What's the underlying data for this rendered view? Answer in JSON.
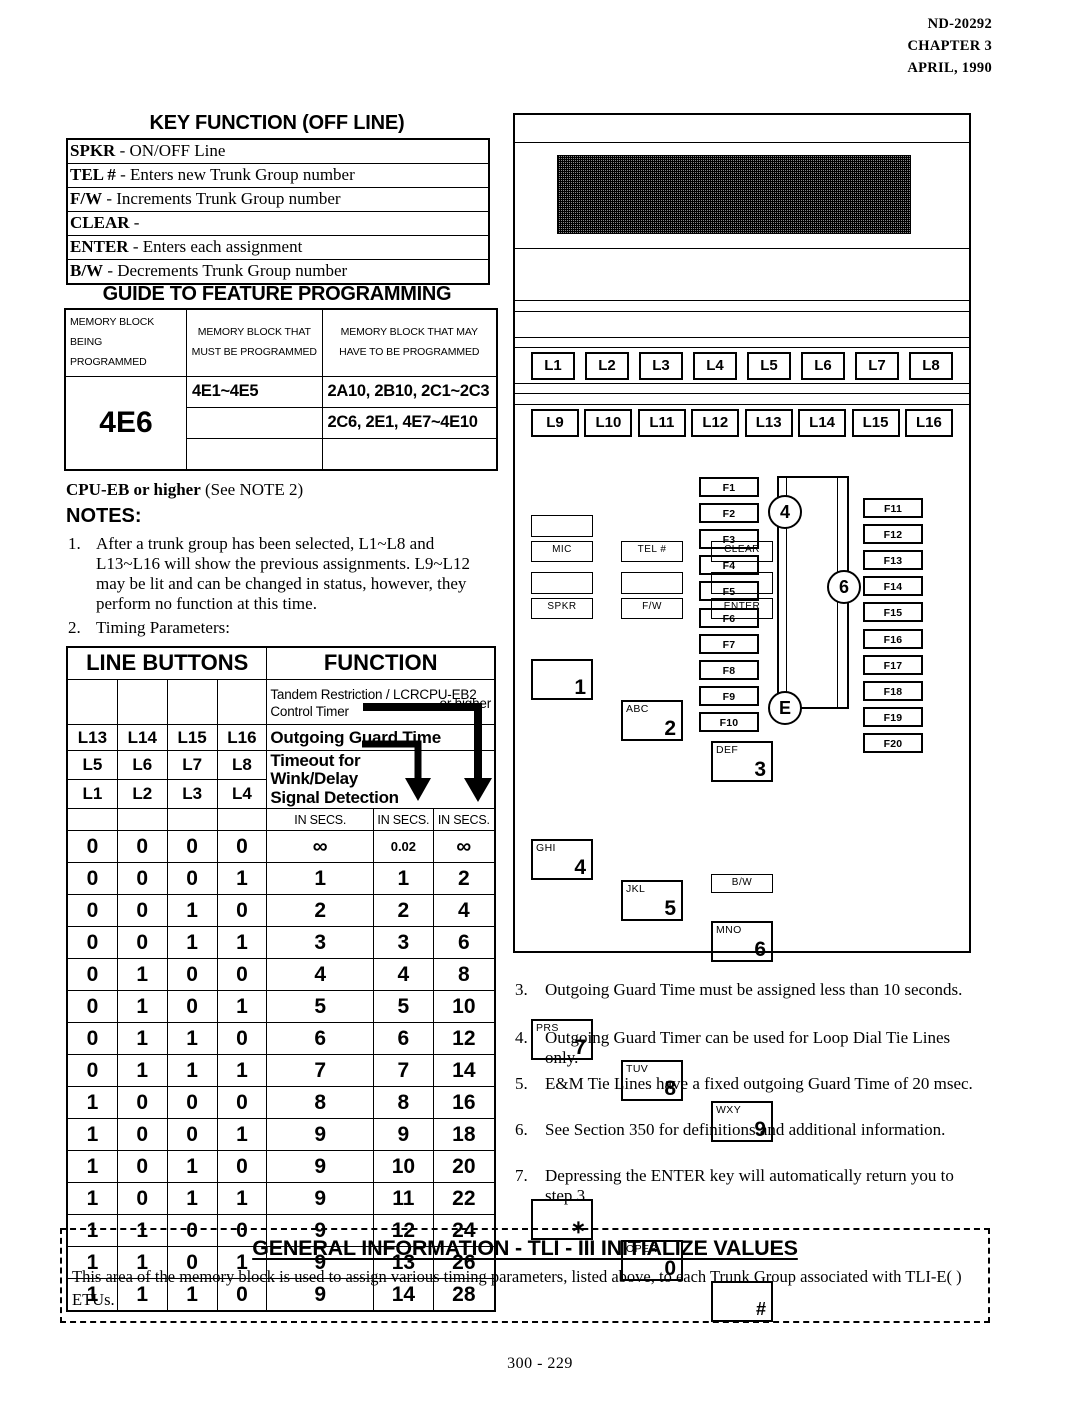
{
  "header": {
    "doc_number": "ND-20292",
    "chapter": "CHAPTER 3",
    "date": "APRIL, 1990"
  },
  "key_function": {
    "title": "KEY FUNCTION (OFF LINE)",
    "rows": [
      {
        "key": "SPKR",
        "desc": "- ON/OFF Line"
      },
      {
        "key": "TEL #",
        "desc": "- Enters new Trunk Group number"
      },
      {
        "key": "F/W",
        "desc": "-  Increments  Trunk Group number"
      },
      {
        "key": "CLEAR",
        "desc": "-"
      },
      {
        "key": "ENTER",
        "desc": "- Enters each assignment"
      },
      {
        "key": "B/W",
        "desc": "-  Decrements Trunk Group number"
      }
    ]
  },
  "guide": {
    "title": "GUIDE TO FEATURE PROGRAMMING",
    "headers": [
      "MEMORY BLOCK BEING PROGRAMMED",
      "MEMORY BLOCK THAT MUST BE PROGRAMMED",
      "MEMORY BLOCK THAT MAY HAVE TO BE PROGRAMMED"
    ],
    "header_lines": [
      [
        "MEMORY BLOCK BEING",
        "PROGRAMMED"
      ],
      [
        "MEMORY BLOCK THAT",
        "MUST BE PROGRAMMED"
      ],
      [
        "MEMORY BLOCK THAT MAY",
        "HAVE TO BE PROGRAMMED"
      ]
    ],
    "memory_block": "4E6",
    "must_be_programmed": [
      "4E1~4E5",
      "",
      ""
    ],
    "may_have_to_be_programmed": [
      "2A10, 2B10, 2C1~2C3",
      "2C6, 2E1, 4E7~4E10",
      ""
    ]
  },
  "cpu_note": "CPU-EB or higher",
  "cpu_note_tail": "(See NOTE 2)",
  "notes_heading": "NOTES:",
  "notes": [
    {
      "num": "1.",
      "text": "After a trunk group has been selected, L1~L8 and L13~L16 will show the previous  assignments. L9~L12 may be lit and can be changed in status, however, they perform no function at this time."
    },
    {
      "num": "2.",
      "text": "Timing Parameters:"
    },
    {
      "num": "3.",
      "text": "Outgoing Guard Time must be assigned less than 10 seconds."
    },
    {
      "num": "4.",
      "text": "Outgoing Guard Timer can be used for Loop Dial Tie Lines only."
    },
    {
      "num": "5.",
      "text": "E&M Tie Lines have a fixed outgoing Guard Time of 20 msec."
    },
    {
      "num": "6.",
      "text": "See Section 350 for definitions and additional information."
    },
    {
      "num": "7.",
      "text": "Depressing the ENTER key will automatically return you to step 3."
    }
  ],
  "timing_table": {
    "group_headers": [
      "LINE BUTTONS",
      "FUNCTION"
    ],
    "function_labels": {
      "tandem": "Tandem Restriction / LCR",
      "tandem2": "Control Timer",
      "cpu_note": "CPU-EB2",
      "cpu_note2": "or higher",
      "outgoing": "Outgoing Guard  Time",
      "timeout": [
        "Timeout for",
        "Wink/Delay",
        "Signal Detection"
      ]
    },
    "button_rows": [
      [
        "L13",
        "L14",
        "L15",
        "L16"
      ],
      [
        "L5",
        "L6",
        "L7",
        "L8"
      ],
      [
        "L1",
        "L2",
        "L3",
        "L4"
      ]
    ],
    "unit_labels": [
      "IN SECS.",
      "IN SECS.",
      "IN SECS."
    ],
    "data": [
      {
        "bits": [
          "0",
          "0",
          "0",
          "0"
        ],
        "v1": "∞",
        "v2": "0.02",
        "v3": "∞"
      },
      {
        "bits": [
          "0",
          "0",
          "0",
          "1"
        ],
        "v1": "1",
        "v2": "1",
        "v3": "2"
      },
      {
        "bits": [
          "0",
          "0",
          "1",
          "0"
        ],
        "v1": "2",
        "v2": "2",
        "v3": "4"
      },
      {
        "bits": [
          "0",
          "0",
          "1",
          "1"
        ],
        "v1": "3",
        "v2": "3",
        "v3": "6"
      },
      {
        "bits": [
          "0",
          "1",
          "0",
          "0"
        ],
        "v1": "4",
        "v2": "4",
        "v3": "8"
      },
      {
        "bits": [
          "0",
          "1",
          "0",
          "1"
        ],
        "v1": "5",
        "v2": "5",
        "v3": "10"
      },
      {
        "bits": [
          "0",
          "1",
          "1",
          "0"
        ],
        "v1": "6",
        "v2": "6",
        "v3": "12"
      },
      {
        "bits": [
          "0",
          "1",
          "1",
          "1"
        ],
        "v1": "7",
        "v2": "7",
        "v3": "14"
      },
      {
        "bits": [
          "1",
          "0",
          "0",
          "0"
        ],
        "v1": "8",
        "v2": "8",
        "v3": "16"
      },
      {
        "bits": [
          "1",
          "0",
          "0",
          "1"
        ],
        "v1": "9",
        "v2": "9",
        "v3": "18"
      },
      {
        "bits": [
          "1",
          "0",
          "1",
          "0"
        ],
        "v1": "9",
        "v2": "10",
        "v3": "20"
      },
      {
        "bits": [
          "1",
          "0",
          "1",
          "1"
        ],
        "v1": "9",
        "v2": "11",
        "v3": "22"
      },
      {
        "bits": [
          "1",
          "1",
          "0",
          "0"
        ],
        "v1": "9",
        "v2": "12",
        "v3": "24"
      },
      {
        "bits": [
          "1",
          "1",
          "0",
          "1"
        ],
        "v1": "9",
        "v2": "13",
        "v3": "26"
      },
      {
        "bits": [
          "1",
          "1",
          "1",
          "0"
        ],
        "v1": "9",
        "v2": "14",
        "v3": "28"
      }
    ]
  },
  "phone": {
    "line_keys_row1": [
      "L1",
      "L2",
      "L3",
      "L4",
      "L5",
      "L6",
      "L7",
      "L8"
    ],
    "line_keys_row2": [
      "L9",
      "L10",
      "L11",
      "L12",
      "L13",
      "L14",
      "L15",
      "L16"
    ],
    "feature_keys": [
      "MIC",
      "TEL #",
      "CLEAR",
      "SPKR",
      "F/W",
      "ENTER"
    ],
    "bw_key": "B/W",
    "dial_keys": [
      {
        "alpha": "",
        "digit": "1"
      },
      {
        "alpha": "ABC",
        "digit": "2"
      },
      {
        "alpha": "DEF",
        "digit": "3"
      },
      {
        "alpha": "GHI",
        "digit": "4"
      },
      {
        "alpha": "JKL",
        "digit": "5"
      },
      {
        "alpha": "MNO",
        "digit": "6"
      },
      {
        "alpha": "PRS",
        "digit": "7"
      },
      {
        "alpha": "TUV",
        "digit": "8"
      },
      {
        "alpha": "WXY",
        "digit": "9"
      },
      {
        "alpha": "",
        "digit": "∗"
      },
      {
        "alpha": "OPER",
        "digit": "0"
      },
      {
        "alpha": "",
        "digit": "#"
      }
    ],
    "fkeys_left": [
      "F1",
      "F2",
      "F3",
      "F4",
      "F5",
      "F6",
      "F7",
      "F8",
      "F9",
      "F10"
    ],
    "fkeys_right": [
      "F11",
      "F12",
      "F13",
      "F14",
      "F15",
      "F16",
      "F17",
      "F18",
      "F19",
      "F20"
    ],
    "callouts": [
      "4",
      "6",
      "E"
    ]
  },
  "general_info": {
    "title": "GENERAL INFORMATION  -  TLI - III  INITIALIZE  VALUES",
    "body": "This area of the memory block is used to assign various timing parameters, listed above, to each Trunk Group associated with TLI-E( ) ETUs."
  },
  "footer": "300 - 229"
}
